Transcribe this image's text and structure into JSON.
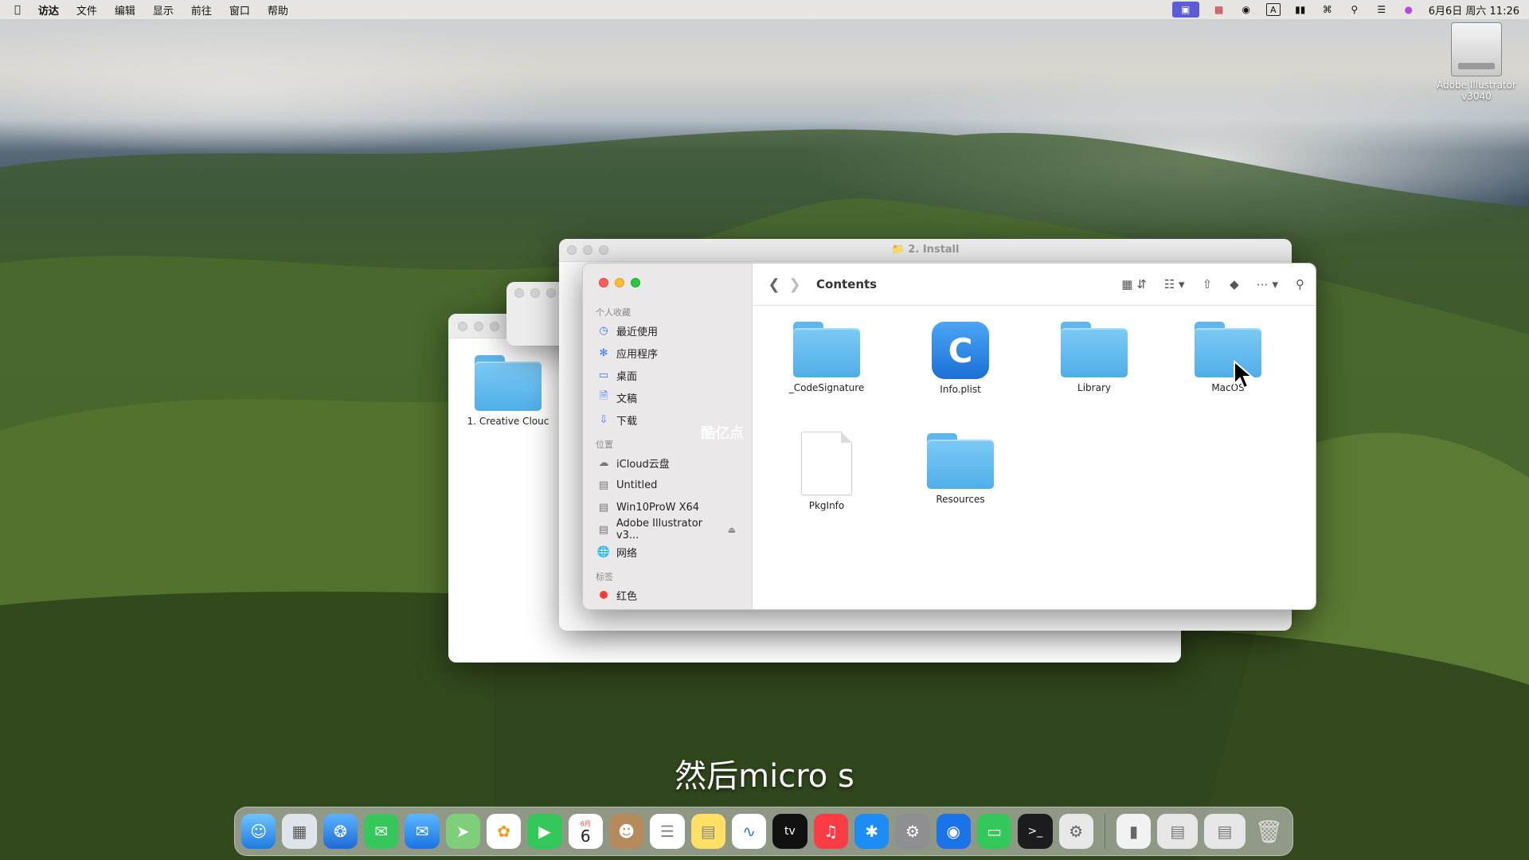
{
  "menubar": {
    "app_name": "访达",
    "menus": [
      "文件",
      "编辑",
      "显示",
      "前往",
      "窗口",
      "帮助"
    ],
    "datetime": "6月6日 周六 11:26",
    "input_indicator": "A"
  },
  "desktop": {
    "drive_label_line1": "Adobe Illustrator",
    "drive_label_line2": "v3040"
  },
  "background_window": {
    "item_label": "1. Creative Clouc"
  },
  "install_window": {
    "title": "2. Install"
  },
  "finder": {
    "path_title": "Contents",
    "sidebar": {
      "favorites_header": "个人收藏",
      "favorites": [
        {
          "label": "最近使用",
          "icon": "clock-icon"
        },
        {
          "label": "应用程序",
          "icon": "apps-icon"
        },
        {
          "label": "桌面",
          "icon": "desktop-icon"
        },
        {
          "label": "文稿",
          "icon": "document-icon"
        },
        {
          "label": "下载",
          "icon": "download-icon"
        }
      ],
      "locations_header": "位置",
      "locations": [
        {
          "label": "iCloud云盘",
          "icon": "cloud-icon"
        },
        {
          "label": "Untitled",
          "icon": "drive-icon"
        },
        {
          "label": "Win10ProW X64",
          "icon": "drive-icon"
        },
        {
          "label": "Adobe Illustrator v3...",
          "icon": "drive-icon"
        },
        {
          "label": "网络",
          "icon": "network-icon"
        }
      ],
      "tags_header": "标签",
      "tags": [
        {
          "label": "红色",
          "color": "#ff3b30"
        }
      ]
    },
    "items": [
      {
        "label": "_CodeSignature",
        "kind": "folder"
      },
      {
        "label": "Info.plist",
        "kind": "plist"
      },
      {
        "label": "Library",
        "kind": "folder"
      },
      {
        "label": "MacOS",
        "kind": "folder"
      },
      {
        "label": "PkgInfo",
        "kind": "document"
      },
      {
        "label": "Resources",
        "kind": "folder"
      }
    ]
  },
  "overlay": {
    "watermark": "酷亿点",
    "subtitle": "然后micro s"
  },
  "dock": {
    "calendar_month": "6月",
    "calendar_day": "6"
  },
  "colors": {
    "folder_blue": "#5db6ec",
    "close_red": "#fe5f57",
    "minimize_yellow": "#febc2e",
    "zoom_green": "#28c840"
  }
}
